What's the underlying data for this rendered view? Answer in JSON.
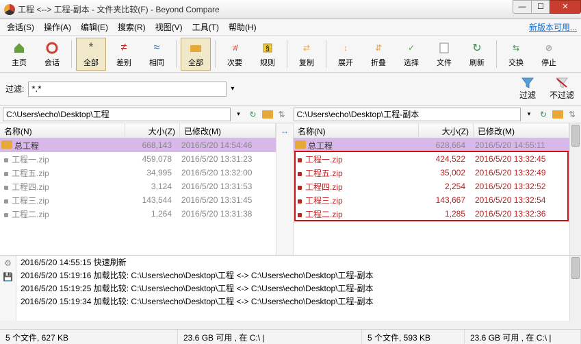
{
  "window": {
    "title": "工程 <--> 工程-副本 - 文件夹比较(F) - Beyond Compare"
  },
  "menu": {
    "session": "会话(S)",
    "action": "操作(A)",
    "edit": "编辑(E)",
    "search": "搜索(R)",
    "view": "视图(V)",
    "tools": "工具(T)",
    "help": "帮助(H)",
    "right_link": "新版本可用..."
  },
  "toolbar": {
    "home": "主页",
    "session_btn": "会话",
    "all1": "全部",
    "diff": "差别",
    "same": "相同",
    "all2": "全部",
    "minor": "次要",
    "rules": "规则",
    "copy": "复制",
    "expand": "展开",
    "collapse": "折叠",
    "select": "选择",
    "files": "文件",
    "refresh": "刷新",
    "swap": "交换",
    "stop": "停止"
  },
  "filter": {
    "label": "过滤:",
    "value": "*.*",
    "filter_btn": "过滤",
    "unfilter_btn": "不过滤"
  },
  "paths": {
    "left": "C:\\Users\\echo\\Desktop\\工程",
    "right": "C:\\Users\\echo\\Desktop\\工程-副本"
  },
  "columns": {
    "name": "名称(N)",
    "size": "大小(Z)",
    "modified": "已修改(M)"
  },
  "left_rows": [
    {
      "type": "folder",
      "name": "总工程",
      "size": "668,143",
      "date": "2016/5/20 14:54:46",
      "cls": "header-folder"
    },
    {
      "type": "file",
      "name": "工程一.zip",
      "size": "459,078",
      "date": "2016/5/20 13:31:23",
      "cls": "gray"
    },
    {
      "type": "file",
      "name": "工程五.zip",
      "size": "34,995",
      "date": "2016/5/20 13:32:00",
      "cls": "gray"
    },
    {
      "type": "file",
      "name": "工程四.zip",
      "size": "3,124",
      "date": "2016/5/20 13:31:53",
      "cls": "gray"
    },
    {
      "type": "file",
      "name": "工程三.zip",
      "size": "143,544",
      "date": "2016/5/20 13:31:45",
      "cls": "gray"
    },
    {
      "type": "file",
      "name": "工程二.zip",
      "size": "1,264",
      "date": "2016/5/20 13:31:38",
      "cls": "gray"
    }
  ],
  "right_rows": [
    {
      "type": "folder",
      "name": "总工程",
      "size": "628,664",
      "date": "2016/5/20 14:55:11",
      "cls": "header-folder"
    },
    {
      "type": "file",
      "name": "工程一.zip",
      "size": "424,522",
      "date": "2016/5/20 13:32:45",
      "cls": "red"
    },
    {
      "type": "file",
      "name": "工程五.zip",
      "size": "35,002",
      "date": "2016/5/20 13:32:49",
      "cls": "red"
    },
    {
      "type": "file",
      "name": "工程四.zip",
      "size": "2,254",
      "date": "2016/5/20 13:32:52",
      "cls": "red"
    },
    {
      "type": "file",
      "name": "工程三.zip",
      "size": "143,667",
      "date": "2016/5/20 13:32:54",
      "cls": "red"
    },
    {
      "type": "file",
      "name": "工程二.zip",
      "size": "1,285",
      "date": "2016/5/20 13:32:36",
      "cls": "red"
    }
  ],
  "log": [
    "2016/5/20 14:55:15  快速刷新",
    "2016/5/20 15:19:16  加载比较: C:\\Users\\echo\\Desktop\\工程 <-> C:\\Users\\echo\\Desktop\\工程-副本",
    "2016/5/20 15:19:25  加载比较: C:\\Users\\echo\\Desktop\\工程 <-> C:\\Users\\echo\\Desktop\\工程-副本",
    "2016/5/20 15:19:34  加载比较: C:\\Users\\echo\\Desktop\\工程 <-> C:\\Users\\echo\\Desktop\\工程-副本"
  ],
  "status": {
    "left_count": "5 个文件, 627 KB",
    "left_disk": "23.6 GB 可用 , 在 C:\\ |",
    "right_count": "5 个文件, 593 KB",
    "right_disk": "23.6 GB 可用 , 在 C:\\ |"
  }
}
